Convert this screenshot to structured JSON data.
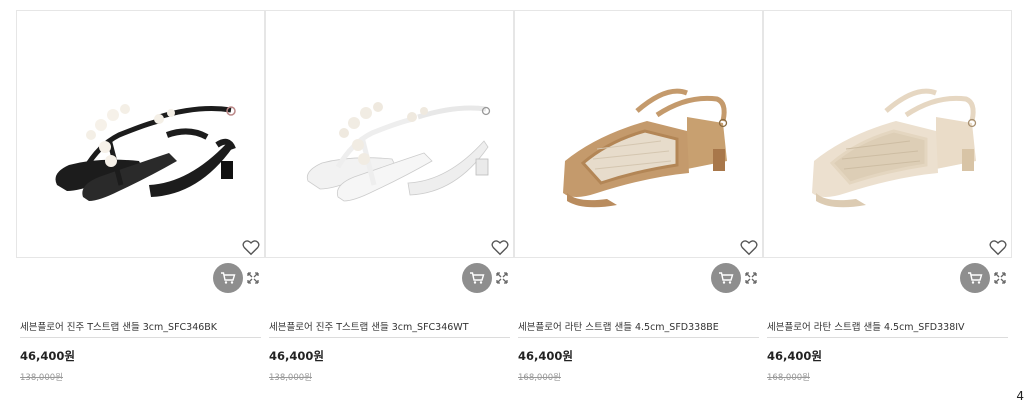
{
  "products": [
    {
      "name": "세븐플로어 진주 T스트랩 샌들 3cm_SFC346BK",
      "price": "46,400원",
      "original_price": "138,000원",
      "color": "#1c1c1c"
    },
    {
      "name": "세븐플로어 진주 T스트랩 샌들 3cm_SFC346WT",
      "price": "46,400원",
      "original_price": "138,000원",
      "color": "#f3f3f3"
    },
    {
      "name": "세븐플로어 라탄 스트랩 샌들 4.5cm_SFD338BE",
      "price": "46,400원",
      "original_price": "168,000원",
      "color": "#c49a6c"
    },
    {
      "name": "세븐플로어 라탄 스트랩 샌들 4.5cm_SFD338IV",
      "price": "46,400원",
      "original_price": "168,000원",
      "color": "#e6d7c2"
    }
  ],
  "icons": {
    "wishlist": "heart-icon",
    "cart": "cart-icon",
    "zoom": "expand-icon"
  },
  "colors": {
    "cart_button": "#8e8e8e",
    "border": "#e6e6e6"
  },
  "corner_glyph": "4"
}
